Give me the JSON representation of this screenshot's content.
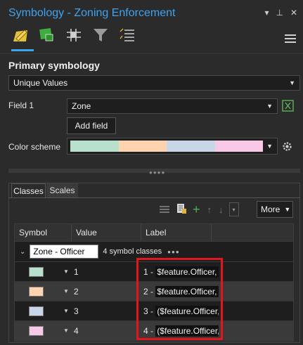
{
  "window": {
    "title": "Symbology - Zoning Enforcement",
    "controls": [
      "▾",
      "⊥",
      "✕"
    ]
  },
  "primary": {
    "heading": "Primary symbology",
    "type_value": "Unique Values"
  },
  "field1": {
    "label": "Field 1",
    "value": "Zone"
  },
  "add_field_label": "Add field",
  "color_scheme": {
    "label": "Color scheme",
    "colors": [
      "#b7e1cd",
      "#fdd3b0",
      "#c9d6ea",
      "#f8c9e6"
    ]
  },
  "tabs": [
    {
      "label": "Classes",
      "active": true
    },
    {
      "label": "Scales",
      "active": false
    }
  ],
  "more_label": "More",
  "table": {
    "headers": [
      "Symbol",
      "Value",
      "Label"
    ],
    "group": {
      "name": "Zone - Officer",
      "count_text": "4 symbol classes",
      "more": "●●●"
    },
    "rows": [
      {
        "value": "1",
        "label_prefix": "1 - ",
        "label_code": "$feature.Officer,",
        "color": "#b7e1cd"
      },
      {
        "value": "2",
        "label_prefix": "2 - ",
        "label_code": "$feature.Officer,",
        "color": "#fdd3b0"
      },
      {
        "value": "3",
        "label_prefix": "3 - ",
        "label_code": "($feature.Officer,",
        "color": "#c9d6ea"
      },
      {
        "value": "4",
        "label_prefix": "4 - ",
        "label_code": "($feature.Officer,",
        "color": "#f8c9e6"
      }
    ]
  }
}
